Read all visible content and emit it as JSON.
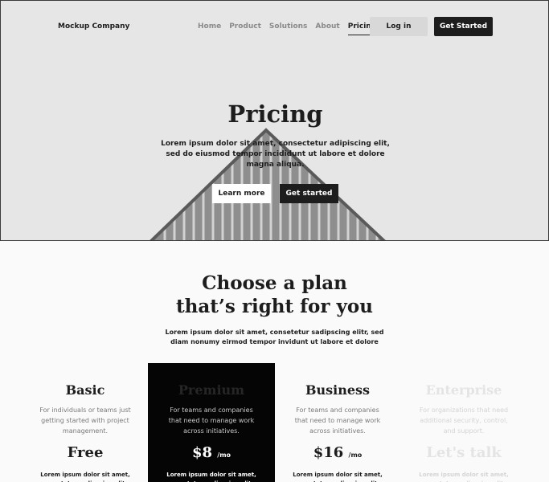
{
  "nav": {
    "brand": "Mockup Company",
    "links": [
      "Home",
      "Product",
      "Solutions",
      "About",
      "Pricing"
    ],
    "active_link": "Pricing",
    "login": "Log in",
    "cta": "Get Started"
  },
  "hero": {
    "title": "Pricing",
    "subtitle": "Lorem ipsum dolor sit amet, consectetur adipiscing elit, sed do eiusmod tempor incididunt ut labore et dolore magna aliqua.",
    "learn_more": "Learn more",
    "get_started": "Get started"
  },
  "plans_section": {
    "title_line1": "Choose a plan",
    "title_line2": "that’s right for you",
    "subtitle": "Lorem ipsum dolor sit amet, consetetur sadipscing elitr, sed diam nonumy eirmod tempor invidunt ut labore et dolore"
  },
  "plans": [
    {
      "name": "Basic",
      "desc": "For individuals or teams just getting started with project management.",
      "price": "Free",
      "unit": "",
      "feature": "Lorem ipsum dolor sit amet, consetetur sadipscing elitr"
    },
    {
      "name": "Premium",
      "desc": "For teams and companies that need to manage work across initiatives.",
      "price": "$8",
      "unit": "/mo",
      "feature": "Lorem ipsum dolor sit amet, consetetur sadipscing elitr"
    },
    {
      "name": "Business",
      "desc": "For teams and companies that need to manage work across initiatives.",
      "price": "$16",
      "unit": "/mo",
      "feature": "Lorem ipsum dolor sit amet, consetetur sadipscing elitr"
    },
    {
      "name": "Enterprise",
      "desc": "For organizations that need additional security, control, and support.",
      "price": "Let's talk",
      "unit": "",
      "feature": "Lorem ipsum dolor sit amet, consetetur sadipscing elitr"
    }
  ],
  "colors": {
    "hero_bg": "#e6e6e6",
    "page_bg": "#fafafa",
    "dark": "#1d1d1d",
    "premium_bg": "#050505",
    "login_bg": "#d8d8d8"
  }
}
